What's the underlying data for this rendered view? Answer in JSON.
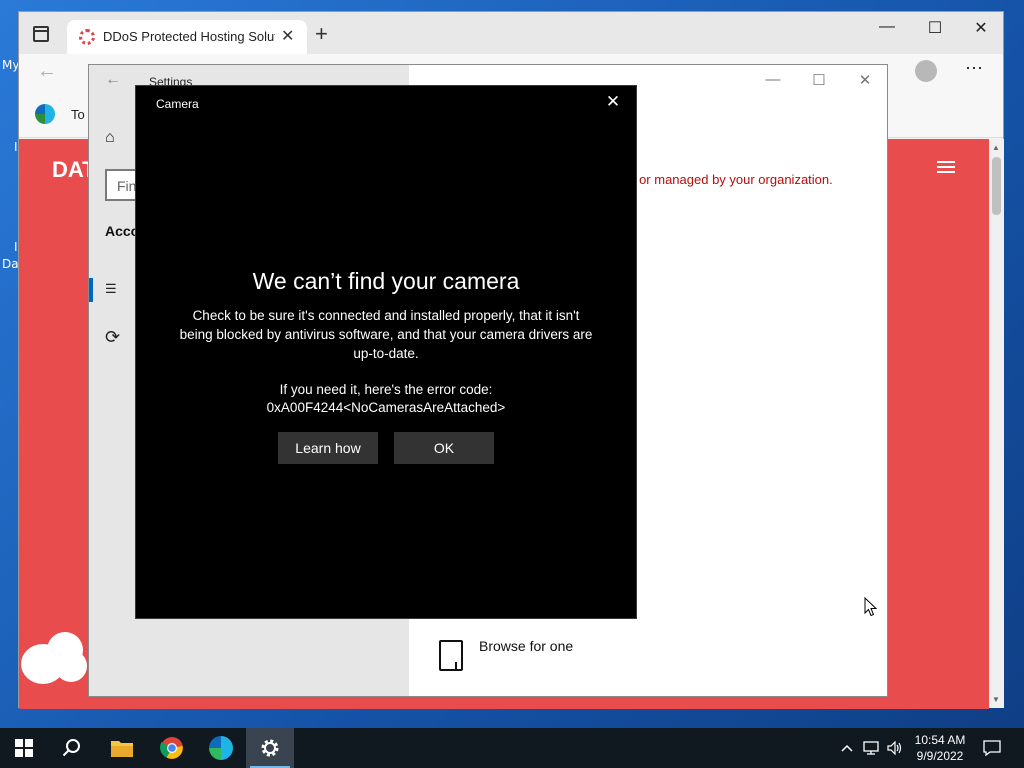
{
  "desktop": {
    "labels": [
      "My",
      "I",
      "I",
      "Da"
    ]
  },
  "browser": {
    "tab_title": "DDoS Protected Hosting Solutio",
    "tab_close": "✕",
    "new_tab": "+",
    "minimize": "—",
    "maximize": "☐",
    "close": "✕",
    "back": "←",
    "favorites_text": "To",
    "page_logo": "DAT",
    "more_menu": "⋯"
  },
  "settings": {
    "title": "Settings",
    "back": "←",
    "search_placeholder": "Fin",
    "accounts_heading": "Acco",
    "minimize": "—",
    "maximize": "☐",
    "close": "✕",
    "warning_text": "en or managed by your organization.",
    "browse_text": "Browse for one"
  },
  "camera": {
    "title": "Camera",
    "close": "✕",
    "heading": "We can’t find your camera",
    "body": "Check to be sure it's connected and installed properly, that it isn't being blocked by antivirus software, and that your camera drivers are up-to-date.",
    "error_label": "If you need it, here's the error code:",
    "error_code": "0xA00F4244<NoCamerasAreAttached>",
    "learn_how": "Learn how",
    "ok": "OK"
  },
  "taskbar": {
    "apps": [
      "start-icon",
      "search-icon",
      "file-explorer-icon",
      "chrome-icon",
      "edge-icon",
      "settings-icon"
    ],
    "active_app": "settings-icon",
    "tray_chevron": "^",
    "time": "10:54 AM",
    "date": "9/9/2022"
  },
  "colors": {
    "page_accent": "#e84c4c",
    "dialog_bg": "#000000",
    "button_bg": "#333333",
    "warning_text": "#b50d0d",
    "taskbar_bg": "#101820"
  }
}
